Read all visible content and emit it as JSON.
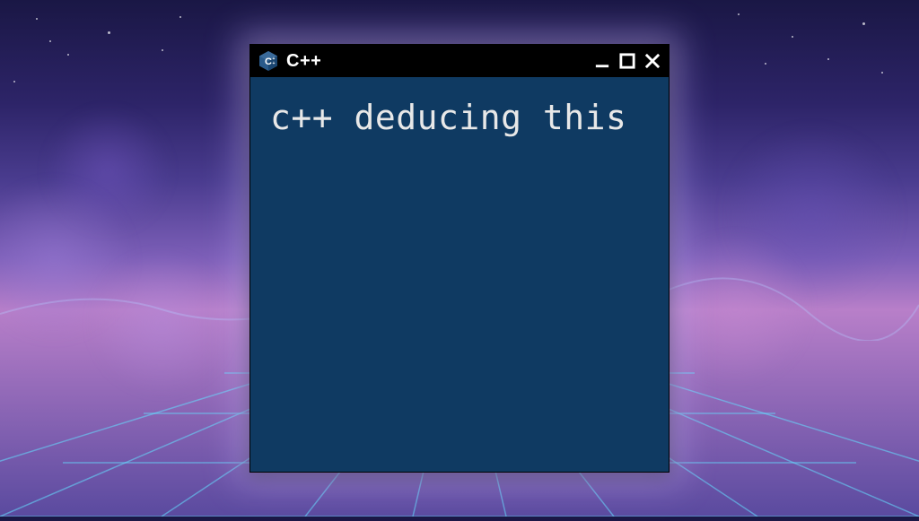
{
  "window": {
    "title": "C++",
    "icon_name": "cpp-icon"
  },
  "terminal": {
    "content": "c++ deducing this"
  },
  "colors": {
    "titlebar_bg": "#000000",
    "terminal_bg": "#0f3a62",
    "terminal_fg": "#e8e8e8",
    "icon_primary": "#5c8dbc",
    "icon_dark": "#1a4e7a"
  }
}
